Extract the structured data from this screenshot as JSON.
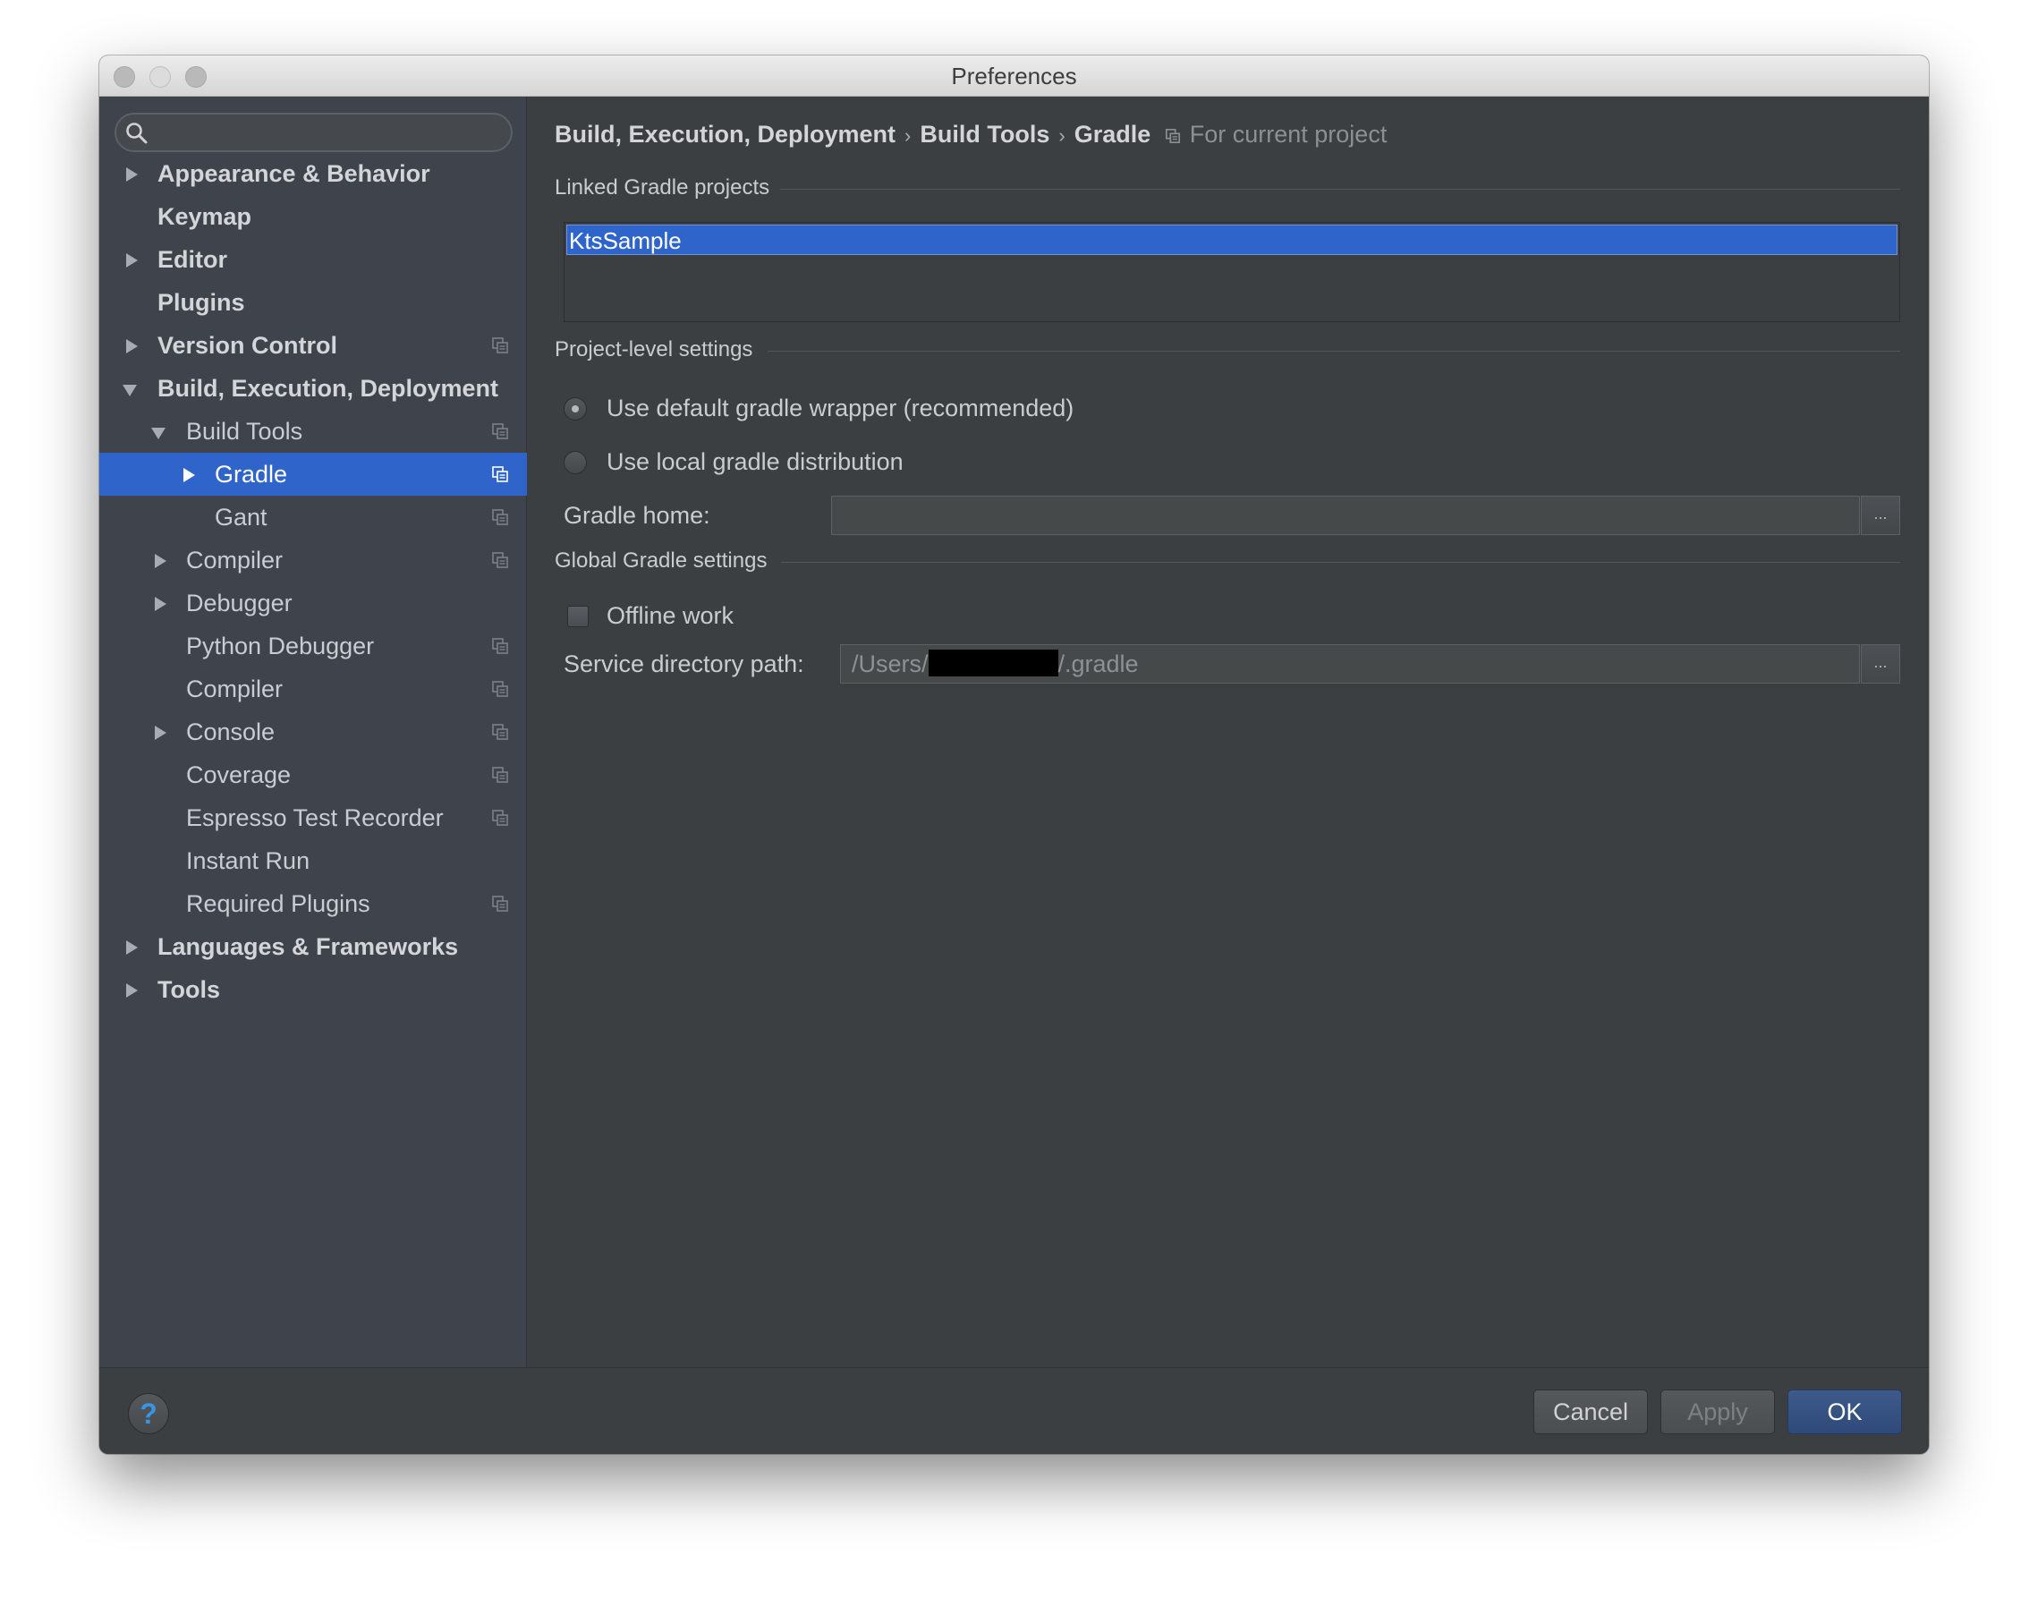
{
  "window": {
    "title": "Preferences"
  },
  "search": {
    "placeholder": ""
  },
  "sidebar": {
    "items": [
      {
        "label": "Appearance & Behavior"
      },
      {
        "label": "Keymap"
      },
      {
        "label": "Editor"
      },
      {
        "label": "Plugins"
      },
      {
        "label": "Version Control"
      },
      {
        "label": "Build, Execution, Deployment"
      },
      {
        "label": "Build Tools"
      },
      {
        "label": "Gradle"
      },
      {
        "label": "Gant"
      },
      {
        "label": "Compiler"
      },
      {
        "label": "Debugger"
      },
      {
        "label": "Python Debugger"
      },
      {
        "label": "Compiler"
      },
      {
        "label": "Console"
      },
      {
        "label": "Coverage"
      },
      {
        "label": "Espresso Test Recorder"
      },
      {
        "label": "Instant Run"
      },
      {
        "label": "Required Plugins"
      },
      {
        "label": "Languages & Frameworks"
      },
      {
        "label": "Tools"
      }
    ]
  },
  "breadcrumb": {
    "items": [
      "Build, Execution, Deployment",
      "Build Tools",
      "Gradle"
    ],
    "separator": "›",
    "scope": "For current project"
  },
  "linked": {
    "title": "Linked Gradle projects",
    "projects": [
      "KtsSample"
    ]
  },
  "project_settings": {
    "title": "Project-level settings",
    "option_default": "Use default gradle wrapper (recommended)",
    "option_local": "Use local gradle distribution",
    "selected": "default",
    "gradle_home_label": "Gradle home:",
    "gradle_home_value": ""
  },
  "global_settings": {
    "title": "Global Gradle settings",
    "offline_label": "Offline work",
    "offline_checked": false,
    "service_dir_label": "Service directory path:",
    "service_dir_prefix": "/Users/",
    "service_dir_suffix": "/.gradle"
  },
  "browse_label": "...",
  "footer": {
    "help": "?",
    "cancel": "Cancel",
    "apply": "Apply",
    "ok": "OK"
  },
  "colors": {
    "selection": "#2f65ca",
    "sidebar_bg": "#3e434c",
    "panel_bg": "#3c3f41"
  }
}
